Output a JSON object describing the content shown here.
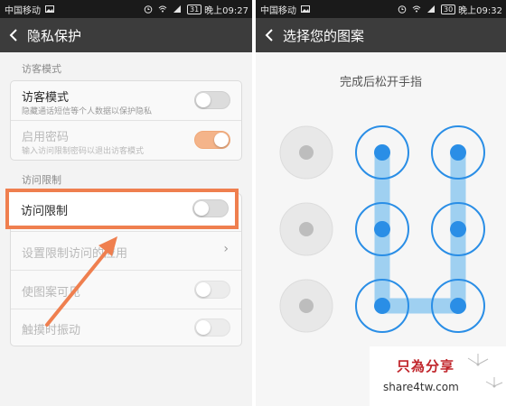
{
  "left": {
    "status": {
      "carrier": "中国移动",
      "battery": "31",
      "time": "晚上09:27"
    },
    "header": {
      "title": "隐私保护"
    },
    "sections": {
      "visitor": "访客模式",
      "access": "访问限制"
    },
    "visitor_mode": {
      "title": "访客模式",
      "subtitle": "隐藏通话短信等个人数据以保护隐私",
      "toggle_on": false
    },
    "enable_password": {
      "title": "启用密码",
      "subtitle": "输入访问限制密码以退出访客模式",
      "toggle_on": true
    },
    "access_limit": {
      "title": "访问限制",
      "toggle_on": false
    },
    "set_apps": {
      "title": "设置限制访问的应用"
    },
    "pattern_visible": {
      "title": "使图案可见",
      "toggle_on": false
    },
    "touch_vibrate": {
      "title": "触摸时振动",
      "toggle_on": false
    },
    "colors": {
      "highlight": "#ef7f4f",
      "accent": "#f4b48a"
    }
  },
  "right": {
    "status": {
      "carrier": "中国移动",
      "battery": "30",
      "time": "晚上09:32"
    },
    "header": {
      "title": "选择您的图案"
    },
    "hint": "完成后松开手指",
    "pattern": {
      "grid": 3,
      "selected_cells": [
        2,
        5,
        8,
        9,
        6,
        3
      ],
      "note": "sequence uses cell numbers 1-9 row-major",
      "dot_color": "#2a8ee6",
      "line_color": "#9fd0f1"
    }
  },
  "watermark": {
    "title": "只為分享",
    "url": "share4tw.com"
  }
}
